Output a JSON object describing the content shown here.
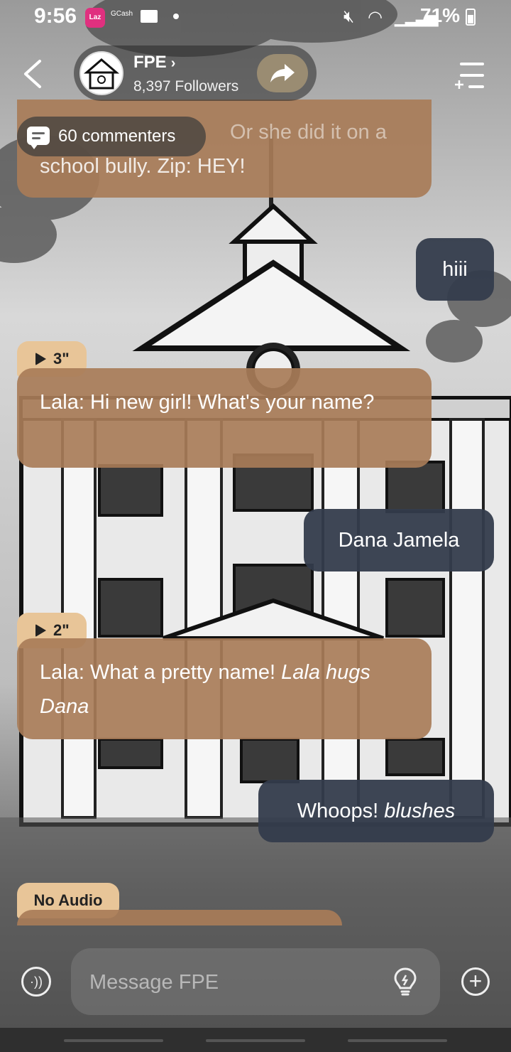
{
  "status_bar": {
    "time": "9:56",
    "laz_label": "Laz",
    "gcash_label": "GCash",
    "battery": "71%"
  },
  "header": {
    "name": "FPE",
    "name_chevron": "›",
    "followers": "8,397 Followers"
  },
  "commenters": {
    "label": "60 commenters"
  },
  "messages": [
    {
      "role": "bot",
      "text": "school bully. Zip: HEY!",
      "partial_top": "Or she did it on a"
    },
    {
      "role": "user",
      "text": "hiii"
    },
    {
      "role": "bot",
      "tag": "3\"",
      "text": "Lala: Hi new girl! What's your name?"
    },
    {
      "role": "user",
      "text": "Dana Jamela"
    },
    {
      "role": "bot",
      "tag": "2\"",
      "text_plain": "Lala: What a pretty name! ",
      "text_italic": "Lala hugs Dana"
    },
    {
      "role": "user",
      "text_plain": "Whoops! ",
      "text_italic": "blushes"
    },
    {
      "role": "bot",
      "tag": "No Audio"
    }
  ],
  "input": {
    "placeholder": "Message FPE"
  },
  "icons": {
    "back": "chevron-left-icon",
    "share": "share-arrow-icon",
    "menu": "menu-icon",
    "voice": "voice-icon",
    "bulb": "lightbulb-icon",
    "plus": "plus-icon"
  },
  "colors": {
    "bot_bubble": "#a87c58",
    "user_bubble": "#343c4c",
    "tag": "#e8c598",
    "share_button": "#9a8c72"
  }
}
